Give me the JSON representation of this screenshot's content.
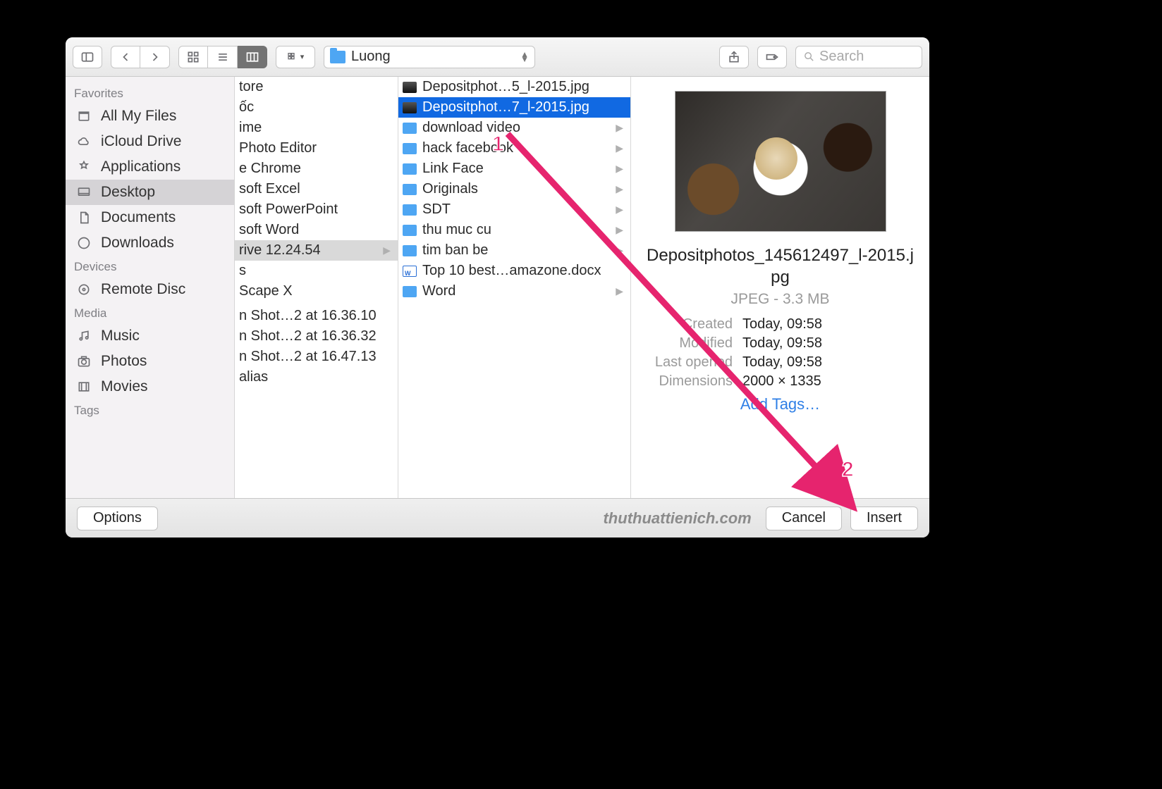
{
  "toolbar": {
    "current_folder": "Luong",
    "search_placeholder": "Search"
  },
  "sidebar": {
    "sections": [
      {
        "header": "Favorites",
        "items": [
          {
            "label": "All My Files"
          },
          {
            "label": "iCloud Drive"
          },
          {
            "label": "Applications"
          },
          {
            "label": "Desktop",
            "selected": true
          },
          {
            "label": "Documents"
          },
          {
            "label": "Downloads"
          }
        ]
      },
      {
        "header": "Devices",
        "items": [
          {
            "label": "Remote Disc"
          }
        ]
      },
      {
        "header": "Media",
        "items": [
          {
            "label": "Music"
          },
          {
            "label": "Photos"
          },
          {
            "label": "Movies"
          }
        ]
      },
      {
        "header": "Tags",
        "items": []
      }
    ]
  },
  "column1": [
    {
      "label": "tore"
    },
    {
      "label": "ốc"
    },
    {
      "label": "ime"
    },
    {
      "label": "Photo Editor"
    },
    {
      "label": "e Chrome"
    },
    {
      "label": "soft Excel"
    },
    {
      "label": "soft PowerPoint"
    },
    {
      "label": "soft Word"
    },
    {
      "label": "rive 12.24.54",
      "selected": true,
      "folder": true
    },
    {
      "label": "s"
    },
    {
      "label": "Scape X"
    },
    {
      "label": ""
    },
    {
      "label": "n Shot…2 at 16.36.10"
    },
    {
      "label": "n Shot…2 at 16.36.32"
    },
    {
      "label": "n Shot…2 at 16.47.13"
    },
    {
      "label": " alias"
    }
  ],
  "column2": [
    {
      "label": "Depositphot…5_l-2015.jpg",
      "type": "img"
    },
    {
      "label": "Depositphot…7_l-2015.jpg",
      "type": "img",
      "highlighted": true
    },
    {
      "label": "download video",
      "type": "folder"
    },
    {
      "label": "hack facebook",
      "type": "folder"
    },
    {
      "label": "Link Face",
      "type": "folder"
    },
    {
      "label": "Originals",
      "type": "folder"
    },
    {
      "label": "SDT",
      "type": "folder"
    },
    {
      "label": "thu muc cu",
      "type": "folder"
    },
    {
      "label": "tim ban be",
      "type": "folder"
    },
    {
      "label": "Top 10 best…amazone.docx",
      "type": "doc"
    },
    {
      "label": "Word",
      "type": "folder"
    }
  ],
  "preview": {
    "filename": "Depositphotos_145612497_l-2015.jpg",
    "format_size": "JPEG - 3.3 MB",
    "created_label": "Created",
    "created": "Today, 09:58",
    "modified_label": "Modified",
    "modified": "Today, 09:58",
    "lastopened_label": "Last opened",
    "lastopened": "Today, 09:58",
    "dimensions_label": "Dimensions",
    "dimensions": "2000 × 1335",
    "add_tags": "Add Tags…"
  },
  "footer": {
    "options": "Options",
    "watermark": "thuthuattienich.com",
    "cancel": "Cancel",
    "insert": "Insert"
  },
  "annotations": {
    "num1": "1",
    "num2": "2"
  }
}
